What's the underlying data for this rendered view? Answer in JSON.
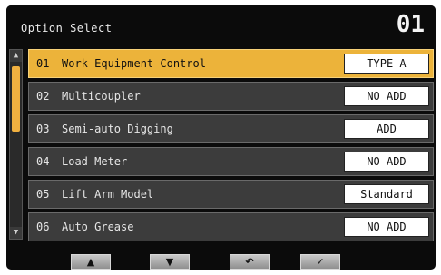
{
  "header": {
    "title": "Option Select",
    "page_number": "01"
  },
  "scrollbar": {
    "up_icon": "▲",
    "down_icon": "▼"
  },
  "rows": [
    {
      "num": "01",
      "label": "Work Equipment Control",
      "value": "TYPE A",
      "selected": true
    },
    {
      "num": "02",
      "label": "Multicoupler",
      "value": "NO ADD",
      "selected": false
    },
    {
      "num": "03",
      "label": "Semi-auto Digging",
      "value": "ADD",
      "selected": false
    },
    {
      "num": "04",
      "label": "Load Meter",
      "value": "NO ADD",
      "selected": false
    },
    {
      "num": "05",
      "label": "Lift Arm Model",
      "value": "Standard",
      "selected": false
    },
    {
      "num": "06",
      "label": "Auto Grease",
      "value": "NO ADD",
      "selected": false
    }
  ],
  "footer": {
    "up_button": "▲",
    "down_button": "▼",
    "back_button": "↶",
    "confirm_button": "✓"
  }
}
